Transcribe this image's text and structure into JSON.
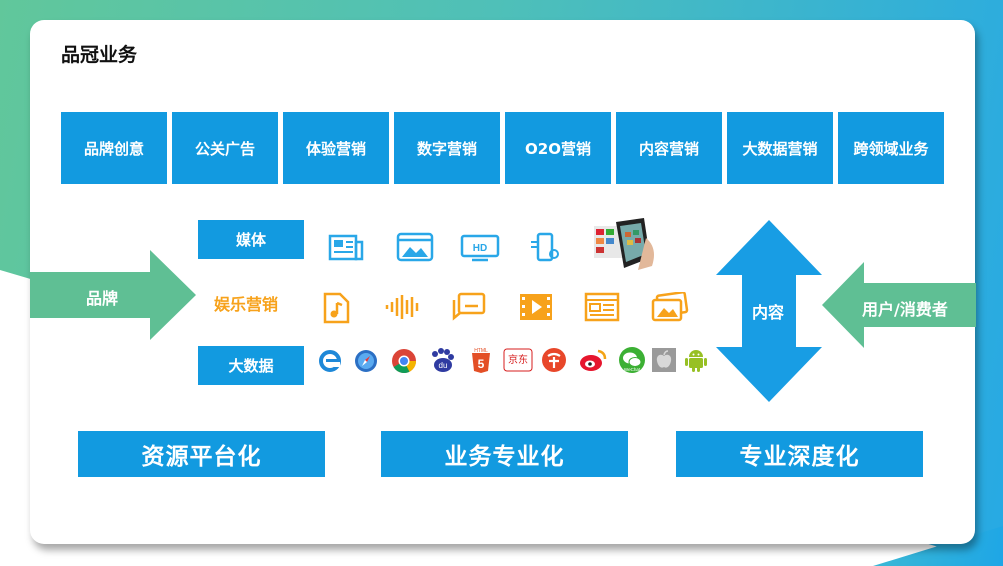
{
  "title": "品冠业务",
  "business": [
    "品牌创意",
    "公关广告",
    "体验营销",
    "数字营销",
    "O2O营销",
    "内容营销",
    "大数据营销",
    "跨领域业务"
  ],
  "rows": {
    "media": "媒体",
    "entertainment": "娱乐营销",
    "bigdata": "大数据"
  },
  "arrows": {
    "brand": "品牌",
    "content": "内容",
    "consumer": "用户/消费者"
  },
  "bottom": [
    "资源平台化",
    "业务专业化",
    "专业深度化"
  ],
  "icon_text": {
    "html": "HTML",
    "html_num": "5",
    "jd": "京东",
    "wechat": "WeChat",
    "hd": "HD"
  },
  "colors": {
    "accent": "#129ae0",
    "green": "#5fbf94",
    "orange": "#f7a21b",
    "arrow_blue": "#189de4"
  },
  "icons": {
    "media": [
      "newspaper-icon",
      "browser-image-icon",
      "hd-monitor-icon",
      "mobile-settings-icon",
      "smartphone-photo"
    ],
    "entertainment": [
      "music-file-icon",
      "audio-wave-icon",
      "chat-bubble-icon",
      "video-play-icon",
      "news-article-icon",
      "image-gallery-icon"
    ],
    "bigdata": [
      "ie-icon",
      "safari-icon",
      "chrome-icon",
      "baidu-icon",
      "html5-icon",
      "jd-icon",
      "taobao-icon",
      "weibo-icon",
      "wechat-icon",
      "apple-icon",
      "android-icon"
    ]
  }
}
